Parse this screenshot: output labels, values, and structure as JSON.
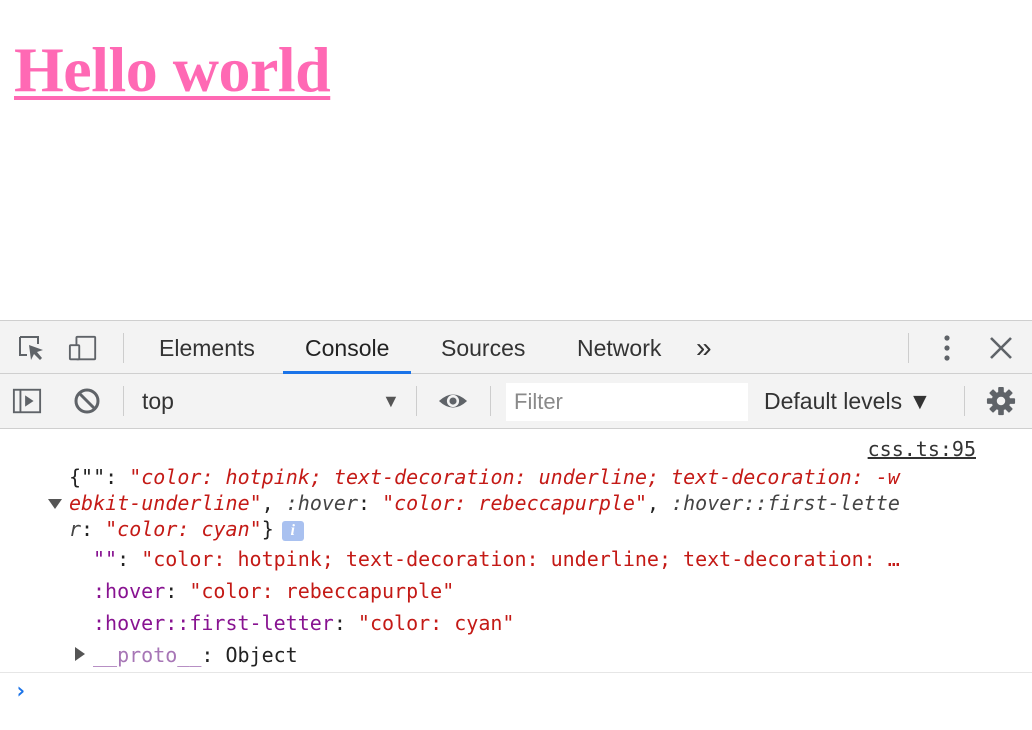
{
  "page": {
    "heading": "Hello world"
  },
  "devtools": {
    "tabs": [
      {
        "label": "Elements"
      },
      {
        "label": "Console"
      },
      {
        "label": "Sources"
      },
      {
        "label": "Network"
      }
    ],
    "more_tabs_glyph": "»",
    "close_glyph": "✕",
    "toolbar": {
      "context": "top",
      "context_arrow": "▼",
      "filter_placeholder": "Filter",
      "levels": "Default levels ▼"
    },
    "console": {
      "source_link": "css.ts:95",
      "obj_line1_prefix": "{\"\": ",
      "obj_line1_str": "\"color: hotpink; text-decoration: underline; text-decoration: -w",
      "obj_line2_str": "ebkit-underline\"",
      "obj_line2_sep": ", ",
      "obj_line2_key": ":hover",
      "obj_line2_colon": ": ",
      "obj_line2_val": "\"color: rebeccapurple\"",
      "obj_line2_sep2": ", ",
      "obj_line2_key2": ":hover::first-lette",
      "obj_line3_key": "r",
      "obj_line3_colon": ": ",
      "obj_line3_val": "\"color: cyan\"",
      "obj_line3_close": "}",
      "info_glyph": "i",
      "prop1_key": "\"\"",
      "prop1_colon": ": ",
      "prop1_val": "\"color: hotpink; text-decoration: underline; text-decoration: …",
      "prop2_key": ":hover",
      "prop2_colon": ": ",
      "prop2_val": "\"color: rebeccapurple\"",
      "prop3_key": ":hover::first-letter",
      "prop3_colon": ": ",
      "prop3_val": "\"color: cyan\"",
      "proto_key": "__proto__",
      "proto_colon": ": ",
      "proto_val": "Object",
      "prompt_glyph": "›"
    },
    "colors": {
      "active_tab_accent": "#1a73e8",
      "string": "#c41a16",
      "key": "#881391",
      "heading": "#ff69b4"
    }
  }
}
